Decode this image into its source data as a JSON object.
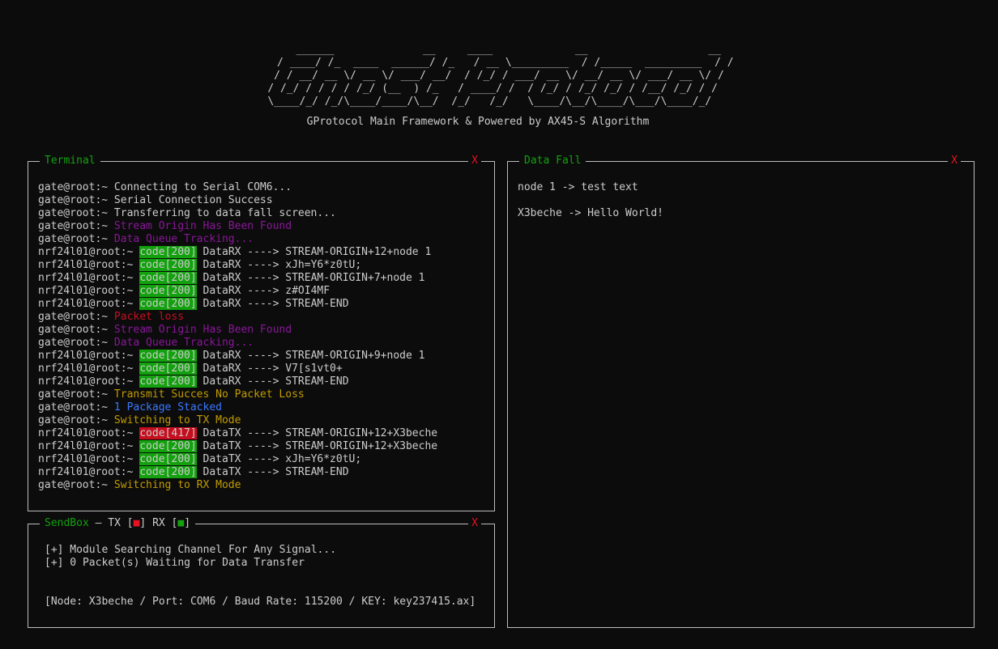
{
  "banner": {
    "art": "   ______              __     ____             __                   __\n  / ____/ /_  ____  ______/ /_   / __ \\_________  / /_____  _________  / /\n / / __/ __ \\/ __ \\/ ___/ __/  / /_/ / ___/ __ \\/ __/ __ \\/ ___/ __ \\/ / \n/ /_/ / / / / /_/ (__  ) /_   / ____/ /  / /_/ / /_/ /_/ / /__/ /_/ / /  \n\\____/_/ /_/\\____/____/\\__/  /_/   /_/   \\____/\\__/\\____/\\___/\\____/_/   ",
    "subtitle": "GProtocol Main Framework & Powered by AX45-S Algorithm"
  },
  "terminal": {
    "title": "Terminal",
    "close": "X",
    "lines": [
      {
        "prompt": "gate@root:~ ",
        "badge": "",
        "badge_color": "",
        "text": "Connecting to Serial COM6...",
        "text_color": "white"
      },
      {
        "prompt": "gate@root:~ ",
        "badge": "",
        "badge_color": "",
        "text": "Serial Connection Success",
        "text_color": "white"
      },
      {
        "prompt": "gate@root:~ ",
        "badge": "",
        "badge_color": "",
        "text": "Transferring to data fall screen...",
        "text_color": "white"
      },
      {
        "prompt": "gate@root:~ ",
        "badge": "",
        "badge_color": "",
        "text": "Stream Origin Has Been Found",
        "text_color": "purple"
      },
      {
        "prompt": "gate@root:~ ",
        "badge": "",
        "badge_color": "",
        "text": "Data Queue Tracking...",
        "text_color": "purple"
      },
      {
        "prompt": "nrf24l01@root:~ ",
        "badge": "code[200]",
        "badge_color": "green",
        "text": " DataRX ----> STREAM-ORIGIN+12+node 1",
        "text_color": "white"
      },
      {
        "prompt": "nrf24l01@root:~ ",
        "badge": "code[200]",
        "badge_color": "green",
        "text": " DataRX ----> xJh=Y6*z0tU;",
        "text_color": "white"
      },
      {
        "prompt": "nrf24l01@root:~ ",
        "badge": "code[200]",
        "badge_color": "green",
        "text": " DataRX ----> STREAM-ORIGIN+7+node 1",
        "text_color": "white"
      },
      {
        "prompt": "nrf24l01@root:~ ",
        "badge": "code[200]",
        "badge_color": "green",
        "text": " DataRX ----> z#OI4MF",
        "text_color": "white"
      },
      {
        "prompt": "nrf24l01@root:~ ",
        "badge": "code[200]",
        "badge_color": "green",
        "text": " DataRX ----> STREAM-END",
        "text_color": "white"
      },
      {
        "prompt": "gate@root:~ ",
        "badge": "",
        "badge_color": "",
        "text": "Packet loss",
        "text_color": "red"
      },
      {
        "prompt": "gate@root:~ ",
        "badge": "",
        "badge_color": "",
        "text": "Stream Origin Has Been Found",
        "text_color": "purple"
      },
      {
        "prompt": "gate@root:~ ",
        "badge": "",
        "badge_color": "",
        "text": "Data Queue Tracking...",
        "text_color": "purple"
      },
      {
        "prompt": "nrf24l01@root:~ ",
        "badge": "code[200]",
        "badge_color": "green",
        "text": " DataRX ----> STREAM-ORIGIN+9+node 1",
        "text_color": "white"
      },
      {
        "prompt": "nrf24l01@root:~ ",
        "badge": "code[200]",
        "badge_color": "green",
        "text": " DataRX ----> V7[s1vt0+",
        "text_color": "white"
      },
      {
        "prompt": "nrf24l01@root:~ ",
        "badge": "code[200]",
        "badge_color": "green",
        "text": " DataRX ----> STREAM-END",
        "text_color": "white"
      },
      {
        "prompt": "gate@root:~ ",
        "badge": "",
        "badge_color": "",
        "text": "Transmit Succes No Packet Loss",
        "text_color": "yellow"
      },
      {
        "prompt": "gate@root:~ ",
        "badge": "",
        "badge_color": "",
        "text": "1 Package Stacked",
        "text_color": "blue"
      },
      {
        "prompt": "gate@root:~ ",
        "badge": "",
        "badge_color": "",
        "text": "Switching to TX Mode",
        "text_color": "yellow"
      },
      {
        "prompt": "nrf24l01@root:~ ",
        "badge": "code[417]",
        "badge_color": "red",
        "text": " DataTX ----> STREAM-ORIGIN+12+X3beche",
        "text_color": "white"
      },
      {
        "prompt": "nrf24l01@root:~ ",
        "badge": "code[200]",
        "badge_color": "green",
        "text": " DataTX ----> STREAM-ORIGIN+12+X3beche",
        "text_color": "white"
      },
      {
        "prompt": "nrf24l01@root:~ ",
        "badge": "code[200]",
        "badge_color": "green",
        "text": " DataTX ----> xJh=Y6*z0tU;",
        "text_color": "white"
      },
      {
        "prompt": "nrf24l01@root:~ ",
        "badge": "code[200]",
        "badge_color": "green",
        "text": " DataTX ----> STREAM-END",
        "text_color": "white"
      },
      {
        "prompt": "gate@root:~ ",
        "badge": "",
        "badge_color": "",
        "text": "Switching to RX Mode",
        "text_color": "yellow"
      }
    ]
  },
  "sendbox": {
    "title": "SendBox",
    "separator": " — ",
    "tx_label": "TX [",
    "rx_label": "] RX [",
    "end_bracket": "]",
    "square": "■",
    "close": "X",
    "lines": [
      "[+] Module Searching Channel For Any Signal...",
      "[+] 0 Packet(s) Waiting for Data Transfer"
    ],
    "info": "[Node: X3beche / Port: COM6 / Baud Rate: 115200 / KEY: key237415.ax]"
  },
  "datafall": {
    "title": "Data Fall",
    "close": "X",
    "lines": [
      "node 1 -> test text",
      "X3beche -> Hello World!"
    ]
  },
  "colors": {
    "background": "#0c0c0c",
    "text": "#cccccc",
    "green": "#13a10e",
    "red": "#c50f1f",
    "purple": "#881798",
    "yellow": "#c19c00",
    "blue": "#3b78ff"
  }
}
